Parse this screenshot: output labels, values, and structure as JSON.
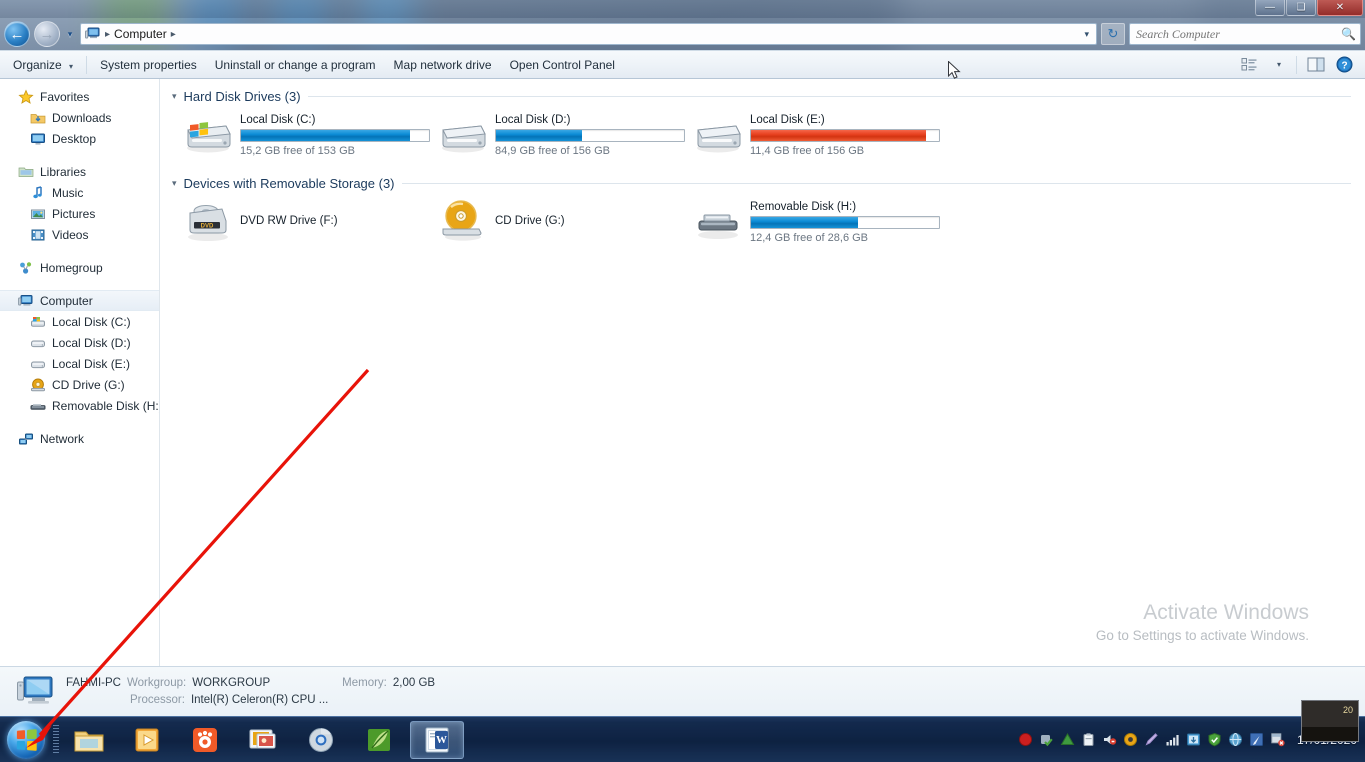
{
  "window": {
    "controls": [
      {
        "name": "minimize",
        "glyph": "—"
      },
      {
        "name": "maximize",
        "glyph": "❑"
      },
      {
        "name": "close",
        "glyph": "✕"
      }
    ]
  },
  "address_bar": {
    "back_glyph": "←",
    "forward_glyph": "→",
    "recent_glyph": "▾",
    "crumbs": [
      "Computer"
    ],
    "crumb_sep": "▸",
    "dropdown_glyph": "▾",
    "refresh_glyph": "↻",
    "refresh_name": "refresh-icon"
  },
  "search": {
    "placeholder": "Search Computer",
    "value": "",
    "icon": "search-icon",
    "icon_glyph": "🔍"
  },
  "toolbar": {
    "organize": "Organize",
    "organize_caret": "▾",
    "system_properties": "System properties",
    "uninstall": "Uninstall or change a program",
    "map_network_drive": "Map network drive",
    "open_control_panel": "Open Control Panel",
    "view_caret": "▾",
    "view_icon": "change-view-icon",
    "preview_icon": "preview-pane-icon",
    "help_icon": "help-icon",
    "help_glyph": "?"
  },
  "sidebar": {
    "groups": [
      {
        "header": {
          "label": "Favorites",
          "icon": "favorites-star-icon"
        },
        "items": [
          {
            "label": "Downloads",
            "icon": "downloads-folder-icon"
          },
          {
            "label": "Desktop",
            "icon": "desktop-icon"
          }
        ]
      },
      {
        "header": {
          "label": "Libraries",
          "icon": "libraries-icon"
        },
        "items": [
          {
            "label": "Music",
            "icon": "music-icon"
          },
          {
            "label": "Pictures",
            "icon": "pictures-icon"
          },
          {
            "label": "Videos",
            "icon": "videos-icon"
          }
        ]
      },
      {
        "header": {
          "label": "Homegroup",
          "icon": "homegroup-icon"
        },
        "items": []
      },
      {
        "header": {
          "label": "Computer",
          "icon": "computer-icon",
          "selected": true
        },
        "items": [
          {
            "label": "Local Disk (C:)",
            "icon": "windows-drive-icon"
          },
          {
            "label": "Local Disk (D:)",
            "icon": "drive-icon"
          },
          {
            "label": "Local Disk (E:)",
            "icon": "drive-icon"
          },
          {
            "label": "CD Drive (G:)",
            "icon": "cd-drive-icon"
          },
          {
            "label": "Removable Disk (H:)",
            "icon": "removable-disk-icon"
          }
        ]
      },
      {
        "header": {
          "label": "Network",
          "icon": "network-icon"
        },
        "items": []
      }
    ]
  },
  "main": {
    "groups": [
      {
        "title": "Hard Disk Drives (3)",
        "triangle": "▾",
        "drives": [
          {
            "name": "Local Disk (C:)",
            "free_text": "15,2 GB free of 153 GB",
            "used_percent": 90,
            "bar_color": "blue",
            "icon": "windows-drive-icon",
            "has_bar": true
          },
          {
            "name": "Local Disk (D:)",
            "free_text": "84,9 GB free of 156 GB",
            "used_percent": 46,
            "bar_color": "blue",
            "icon": "drive-icon",
            "has_bar": true
          },
          {
            "name": "Local Disk (E:)",
            "free_text": "11,4 GB free of 156 GB",
            "used_percent": 93,
            "bar_color": "red",
            "icon": "drive-icon",
            "has_bar": true
          }
        ]
      },
      {
        "title": "Devices with Removable Storage (3)",
        "triangle": "▾",
        "drives": [
          {
            "name": "DVD RW Drive (F:)",
            "free_text": "",
            "used_percent": 0,
            "bar_color": "blue",
            "icon": "dvd-rw-drive-icon",
            "has_bar": false
          },
          {
            "name": "CD Drive (G:)",
            "free_text": "",
            "used_percent": 0,
            "bar_color": "blue",
            "icon": "cd-drive-icon",
            "has_bar": false
          },
          {
            "name": "Removable Disk (H:)",
            "free_text": "12,4 GB free of 28,6 GB",
            "used_percent": 57,
            "bar_color": "blue",
            "icon": "removable-disk-icon",
            "has_bar": true
          }
        ]
      }
    ]
  },
  "details": {
    "computer_name": "FAHMI-PC",
    "workgroup_label": "Workgroup:",
    "workgroup_value": "WORKGROUP",
    "memory_label": "Memory:",
    "memory_value": "2,00 GB",
    "processor_label": "Processor:",
    "processor_value": "Intel(R) Celeron(R) CPU ..."
  },
  "watermark": {
    "title": "Activate Windows",
    "subtitle": "Go to Settings to activate Windows."
  },
  "taskbar": {
    "start_name": "start-orb",
    "apps": [
      {
        "name": "file-explorer",
        "icon": "folder-icon",
        "active": false
      },
      {
        "name": "media-player",
        "icon": "media-player-icon",
        "active": false
      },
      {
        "name": "gnome-app",
        "icon": "orange-app-icon",
        "active": false
      },
      {
        "name": "photo-viewer",
        "icon": "photo-app-icon",
        "active": false
      },
      {
        "name": "chrome",
        "icon": "chrome-icon",
        "active": false
      },
      {
        "name": "green-app",
        "icon": "green-leaf-icon",
        "active": false
      },
      {
        "name": "word",
        "icon": "word-icon",
        "active": true
      }
    ],
    "tray": [
      {
        "name": "recorder-icon",
        "color": "#cc1f1f"
      },
      {
        "name": "driver-check-icon",
        "color": "#9fb0bf"
      },
      {
        "name": "triangle-icon",
        "color": "#3f9b3f"
      },
      {
        "name": "clipboard-icon",
        "color": "#dfe6ec"
      },
      {
        "name": "speaker-icon",
        "color": "#d83a2c"
      },
      {
        "name": "antivirus-icon",
        "color": "#e8a516"
      },
      {
        "name": "pen-icon",
        "color": "#c7b7e8"
      },
      {
        "name": "signal-icon",
        "color": "#dfe6ec"
      },
      {
        "name": "update-icon",
        "color": "#4a9fd8"
      },
      {
        "name": "shield-green-icon",
        "color": "#4aa33c"
      },
      {
        "name": "globe-icon",
        "color": "#5aa3cf"
      },
      {
        "name": "blue-arrow-icon",
        "color": "#3f6fb5"
      },
      {
        "name": "flag-icon",
        "color": "#d8e0e8"
      }
    ],
    "clock_date": "17/01/2020",
    "thumb_label": "20"
  }
}
